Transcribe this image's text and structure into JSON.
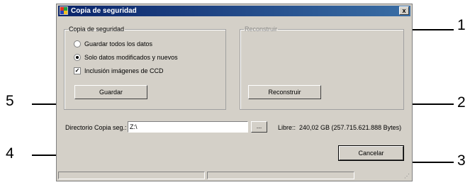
{
  "window": {
    "title": "Copia de seguridad",
    "close_label": "x"
  },
  "backup_group": {
    "legend": "Copia de seguridad",
    "option_all": "Guardar todos los datos",
    "option_modified": "Solo datos modificados y nuevos",
    "include_ccd": "Inclusión imágenes de CCD",
    "save_button": "Guardar"
  },
  "restore_group": {
    "legend": "Reconstruir",
    "rebuild_button": "Reconstruir"
  },
  "directory": {
    "label": "Directorio Copia seg.:",
    "value": "Z:\\",
    "browse_label": "..."
  },
  "free_space": {
    "label": "Libre::",
    "value": "240,02 GB (257.715.621.888 Bytes)"
  },
  "cancel_button": "Cancelar",
  "callouts": [
    "1",
    "2",
    "3",
    "4",
    "5"
  ],
  "colors": {
    "window_bg": "#d4d0c8",
    "title_bar": "#0a246a"
  }
}
